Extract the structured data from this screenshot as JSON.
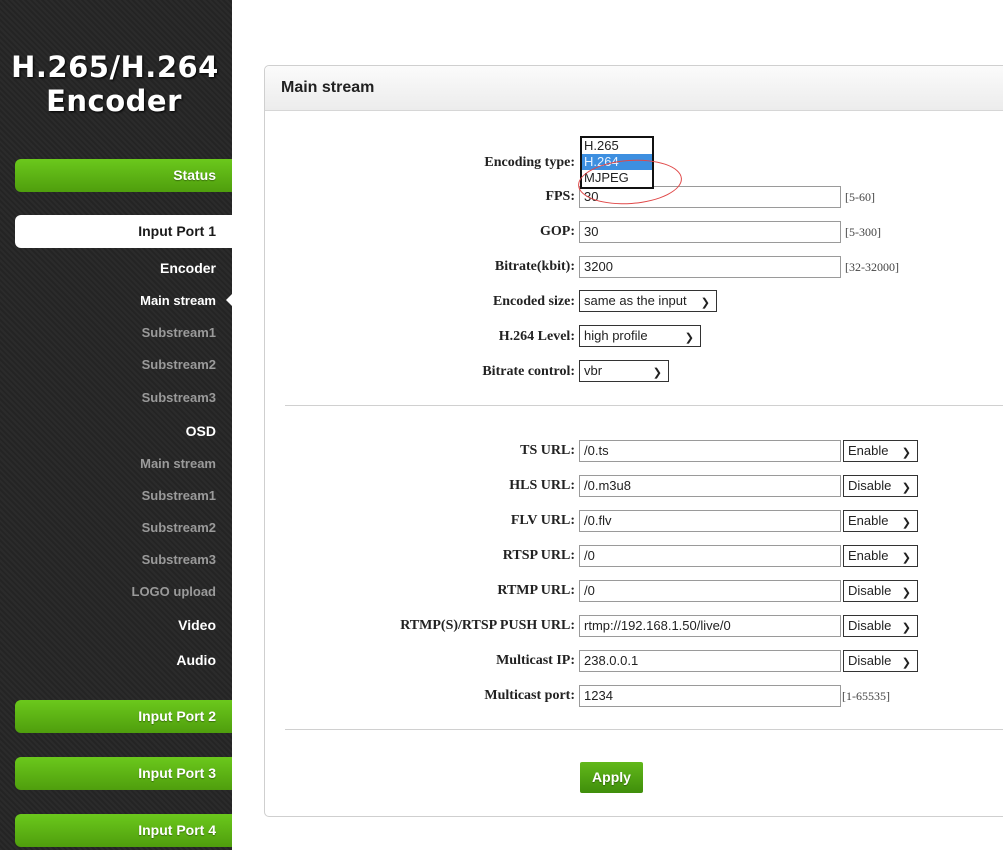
{
  "sidebar": {
    "logo_line1": "H.265/H.264",
    "logo_line2": "Encoder",
    "status": "Status",
    "input_port_1": "Input Port 1",
    "encoder": "Encoder",
    "encoder_items": [
      "Main stream",
      "Substream1",
      "Substream2",
      "Substream3"
    ],
    "osd": "OSD",
    "osd_items": [
      "Main stream",
      "Substream1",
      "Substream2",
      "Substream3"
    ],
    "logo_upload": "LOGO upload",
    "video": "Video",
    "audio": "Audio",
    "input_port_2": "Input Port 2",
    "input_port_3": "Input Port 3",
    "input_port_4": "Input Port 4",
    "active_item": "Main stream"
  },
  "panel": {
    "title": "Main stream"
  },
  "encoding": {
    "encoding_type_label": "Encoding type:",
    "encoding_type_options": [
      "H.265",
      "H.264",
      "MJPEG"
    ],
    "encoding_type_selected": "H.264",
    "fps_label": "FPS:",
    "fps_value": "30",
    "fps_range": "[5-60]",
    "gop_label": "GOP:",
    "gop_value": "30",
    "gop_range": "[5-300]",
    "bitrate_label": "Bitrate(kbit):",
    "bitrate_value": "3200",
    "bitrate_range": "[32-32000]",
    "encoded_size_label": "Encoded size:",
    "encoded_size_value": "same as the input",
    "level_label": "H.264 Level:",
    "level_value": "high profile",
    "bitrate_control_label": "Bitrate control:",
    "bitrate_control_value": "vbr"
  },
  "urls": {
    "ts_label": "TS URL:",
    "ts_value": "/0.ts",
    "ts_state": "Enable",
    "hls_label": "HLS URL:",
    "hls_value": "/0.m3u8",
    "hls_state": "Disable",
    "flv_label": "FLV URL:",
    "flv_value": "/0.flv",
    "flv_state": "Enable",
    "rtsp_label": "RTSP URL:",
    "rtsp_value": "/0",
    "rtsp_state": "Enable",
    "rtmp_label": "RTMP URL:",
    "rtmp_value": "/0",
    "rtmp_state": "Disable",
    "push_label": "RTMP(S)/RTSP PUSH URL:",
    "push_value": "rtmp://192.168.1.50/live/0",
    "push_state": "Disable",
    "mip_label": "Multicast IP:",
    "mip_value": "238.0.0.1",
    "mip_state": "Disable",
    "mport_label": "Multicast port:",
    "mport_value": "1234",
    "mport_range": "[1-65535]"
  },
  "apply_label": "Apply",
  "colors": {
    "sidebar_bg": "#262626",
    "accent_green": "#5cb814",
    "highlight_blue": "#3d8fe0",
    "annotation_red": "#e04848"
  }
}
